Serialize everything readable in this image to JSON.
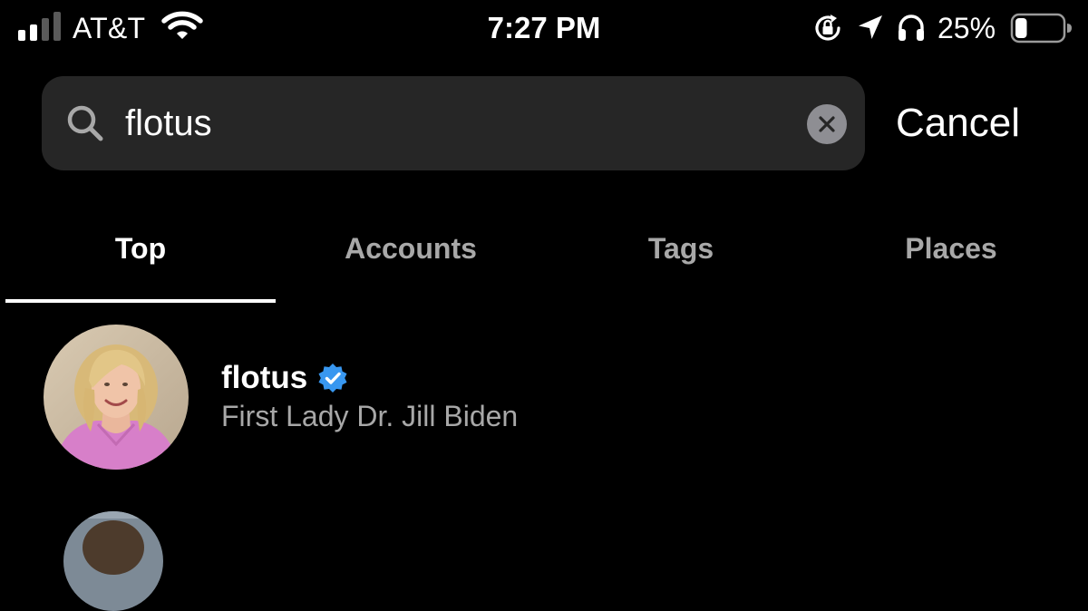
{
  "status_bar": {
    "carrier": "AT&T",
    "time": "7:27 PM",
    "battery_percent": "25%",
    "battery_level": 0.25,
    "signal_bars_filled": 2,
    "signal_bars_total": 4,
    "icons": [
      "signal-icon",
      "wifi-icon",
      "rotation-lock-icon",
      "location-arrow-icon",
      "headphones-icon",
      "battery-icon"
    ]
  },
  "search": {
    "value": "flotus",
    "cancel_label": "Cancel",
    "icon": "search-icon",
    "clear_icon": "clear-icon"
  },
  "tabs": [
    {
      "label": "Top",
      "active": true
    },
    {
      "label": "Accounts",
      "active": false
    },
    {
      "label": "Tags",
      "active": false
    },
    {
      "label": "Places",
      "active": false
    }
  ],
  "results": [
    {
      "username": "flotus",
      "verified": true,
      "full_name": "First Lady Dr. Jill Biden"
    }
  ],
  "colors": {
    "background": "#000000",
    "search_field": "#262626",
    "secondary_text": "#a8a8a8",
    "verified_blue": "#3897f0",
    "clear_button": "#8e8e93"
  }
}
